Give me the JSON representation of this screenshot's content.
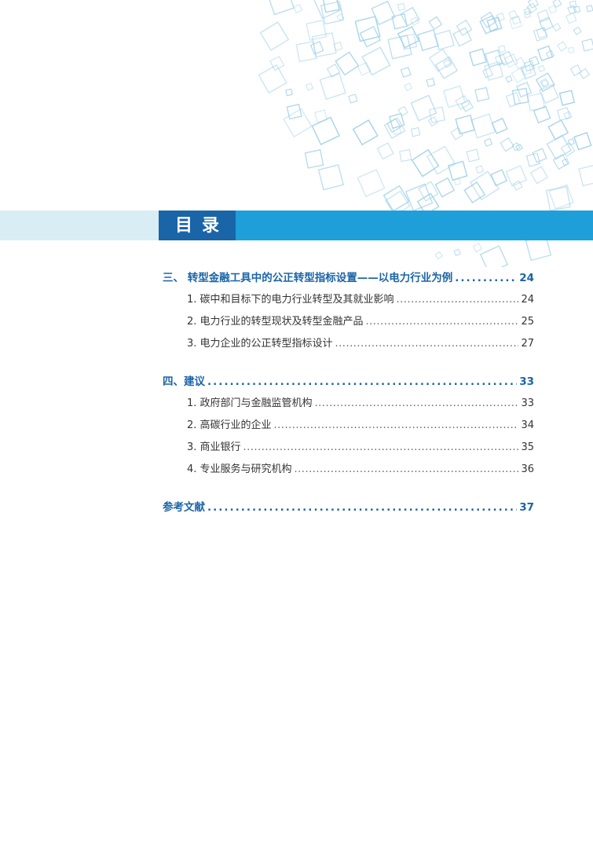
{
  "header": {
    "title": "目录"
  },
  "toc": {
    "sections": [
      {
        "label": "三、 转型金融工具中的公正转型指标设置——以电力行业为例",
        "page": "24",
        "items": [
          {
            "label": "1. 碳中和目标下的电力行业转型及其就业影响",
            "page": "24"
          },
          {
            "label": "2. 电力行业的转型现状及转型金融产品",
            "page": "25"
          },
          {
            "label": "3. 电力企业的公正转型指标设计",
            "page": "27"
          }
        ]
      },
      {
        "label": "四、建议",
        "page": "33",
        "items": [
          {
            "label": "1. 政府部门与金融监管机构",
            "page": "33"
          },
          {
            "label": "2. 高碳行业的企业",
            "page": "34"
          },
          {
            "label": "3. 商业银行",
            "page": "35"
          },
          {
            "label": "4. 专业服务与研究机构",
            "page": "36"
          }
        ]
      },
      {
        "label": "参考文献",
        "page": "37",
        "items": []
      }
    ]
  },
  "colors": {
    "accent_dark": "#1a64a8",
    "accent_bright": "#1f9fd9",
    "band_light": "#d9edf5",
    "decor_square": "#9fcfe8"
  }
}
